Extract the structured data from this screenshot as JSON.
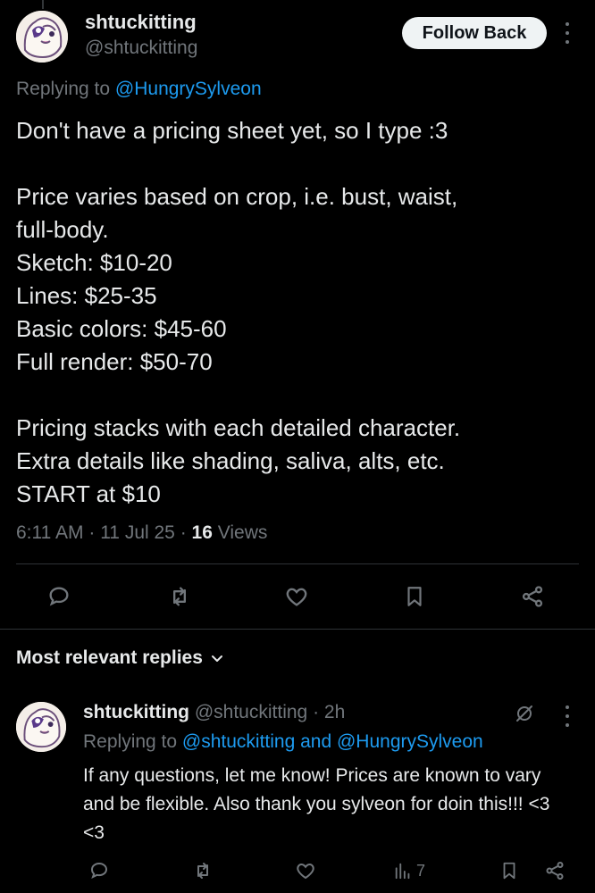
{
  "post": {
    "display_name": "shtuckitting",
    "handle": "@shtuckitting",
    "follow_label": "Follow Back",
    "replying_prefix": "Replying to",
    "replying_to": "@HungrySylveon",
    "text_lines": [
      "Don't have a pricing sheet yet, so I type :3",
      "",
      "Price varies based on crop, i.e. bust, waist,",
      "full-body.",
      "Sketch: $10-20",
      "Lines: $25-35",
      "Basic colors: $45-60",
      "Full render: $50-70",
      "",
      "Pricing stacks with each detailed character.",
      "Extra details like shading, saliva, alts, etc.",
      "START at $10"
    ],
    "time": "6:11 AM",
    "date": "11 Jul 25",
    "views_count": "16",
    "views_label": "Views",
    "separator": "·"
  },
  "actions": {
    "icons": [
      "reply-icon",
      "retweet-icon",
      "like-icon",
      "bookmark-icon",
      "share-icon"
    ]
  },
  "replies_section": {
    "title": "Most relevant replies"
  },
  "reply": {
    "display_name": "shtuckitting",
    "handle": "@shtuckitting",
    "separator": "·",
    "time_ago": "2h",
    "replying_prefix": "Replying to",
    "replying_to": "@shtuckitting and @HungrySylveon",
    "text": "If any questions, let me know! Prices are known to vary and be flexible. Also thank you sylveon for doin this!!! <3 <3",
    "views": "7"
  },
  "colors": {
    "background": "#000000",
    "text": "#e7e9ea",
    "muted": "#71767b",
    "link": "#1d9bf0",
    "divider": "#2f3336"
  }
}
